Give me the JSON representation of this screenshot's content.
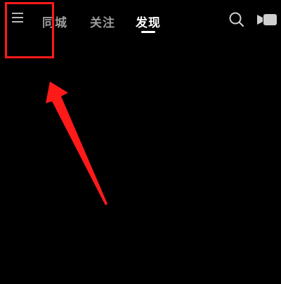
{
  "header": {
    "menu_icon": "hamburger-menu-icon",
    "tabs": [
      {
        "label": "同城",
        "active": false
      },
      {
        "label": "关注",
        "active": false
      },
      {
        "label": "发现",
        "active": true
      }
    ],
    "search_icon": "search-icon",
    "camera_icon": "video-camera-icon"
  },
  "annotation": {
    "highlight_color": "#ff1a1a",
    "target": "menu-button"
  },
  "colors": {
    "background": "#000000",
    "active_tab": "#ffffff",
    "inactive_tab": "#9c9c9c",
    "annotation": "#ff1a1a"
  }
}
